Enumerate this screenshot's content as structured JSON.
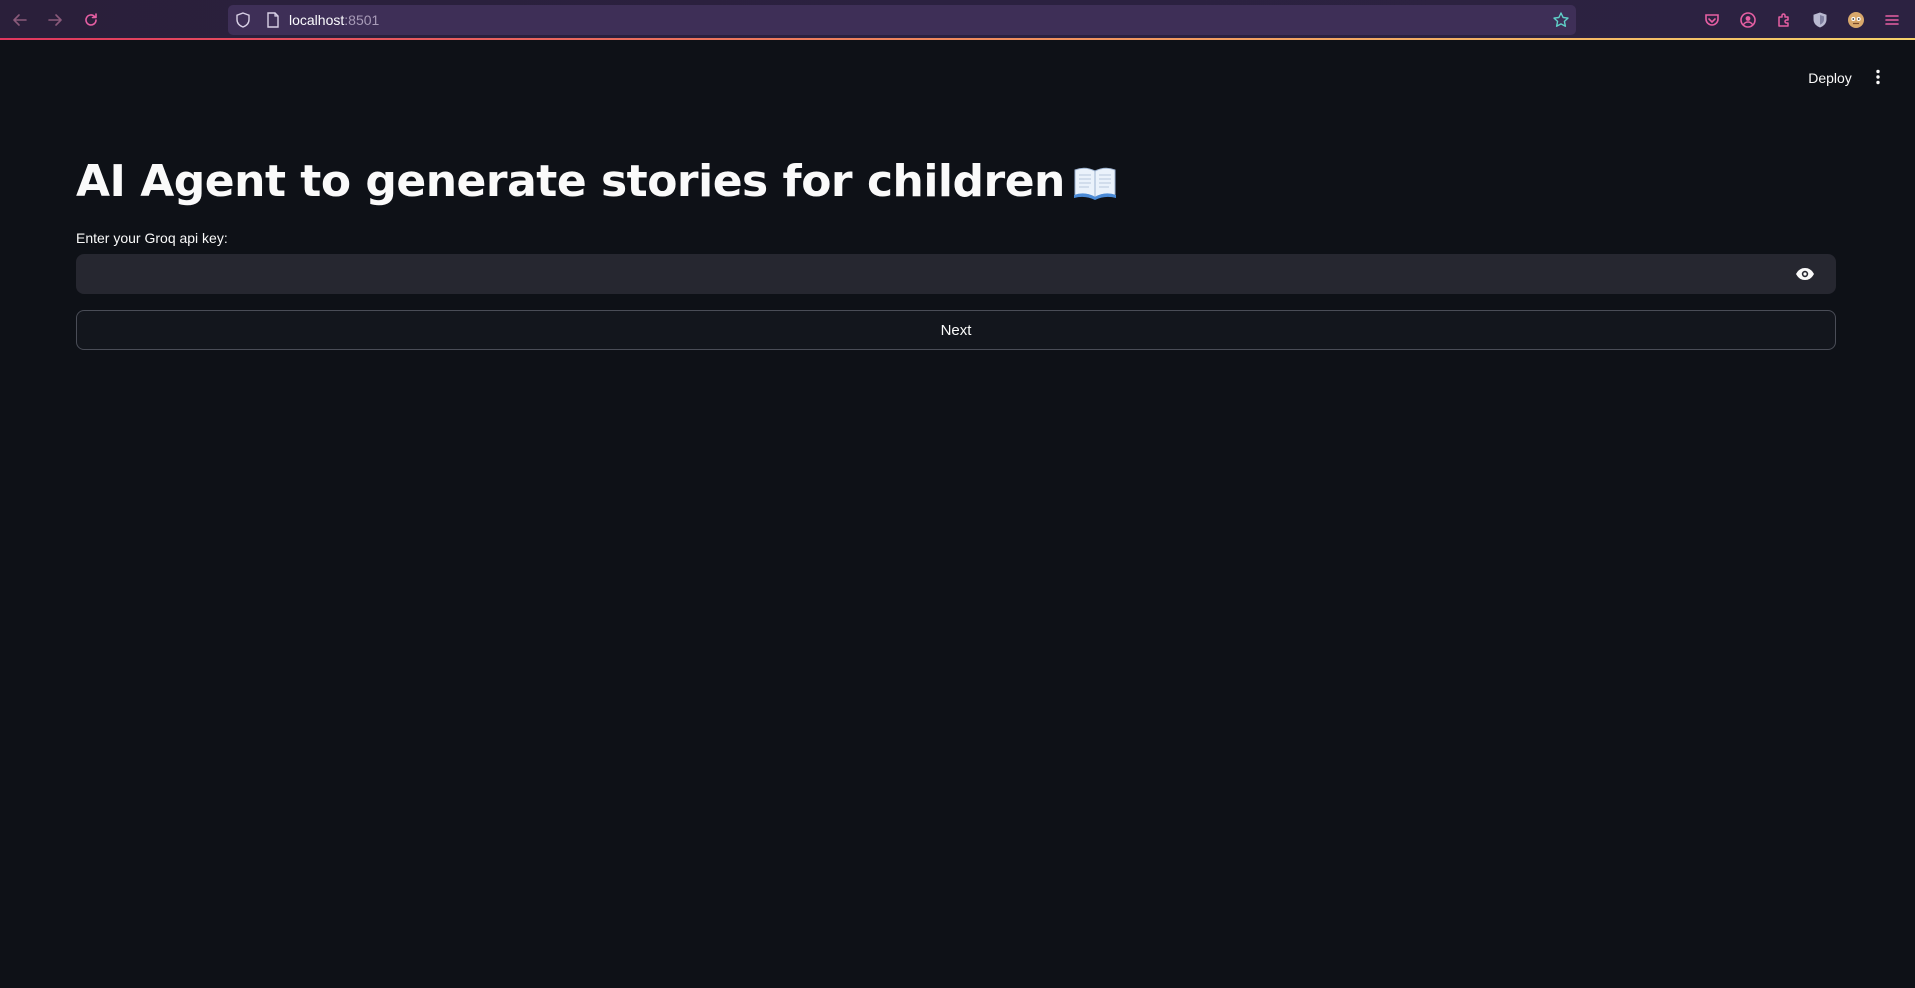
{
  "browser": {
    "url_host": "localhost",
    "url_port": ":8501",
    "colors": {
      "toolbar_bg": "#2b2140",
      "url_bar_bg": "#3e2f57",
      "icon_accent": "#e65fa3",
      "nav_icon": "#8a6a9a"
    },
    "icons": [
      "back-arrow-icon",
      "forward-arrow-icon",
      "reload-icon",
      "shield-icon",
      "page-icon",
      "star-icon",
      "pocket-icon",
      "account-icon",
      "extensions-icon",
      "ublock-icon",
      "profile-avatar-icon",
      "hamburger-menu-icon"
    ]
  },
  "header": {
    "deploy_label": "Deploy",
    "menu_icon": "vertical-dots-icon"
  },
  "main": {
    "title": "AI Agent to generate stories for children",
    "title_icon": "open-book-icon",
    "api_key_label": "Enter your Groq api key:",
    "api_key_value": "",
    "api_key_toggle_icon": "eye-icon",
    "next_label": "Next"
  },
  "theme": {
    "page_bg": "#0e1117",
    "input_bg": "#262730",
    "text_color": "#fafafa",
    "button_border": "#4a4d57"
  }
}
